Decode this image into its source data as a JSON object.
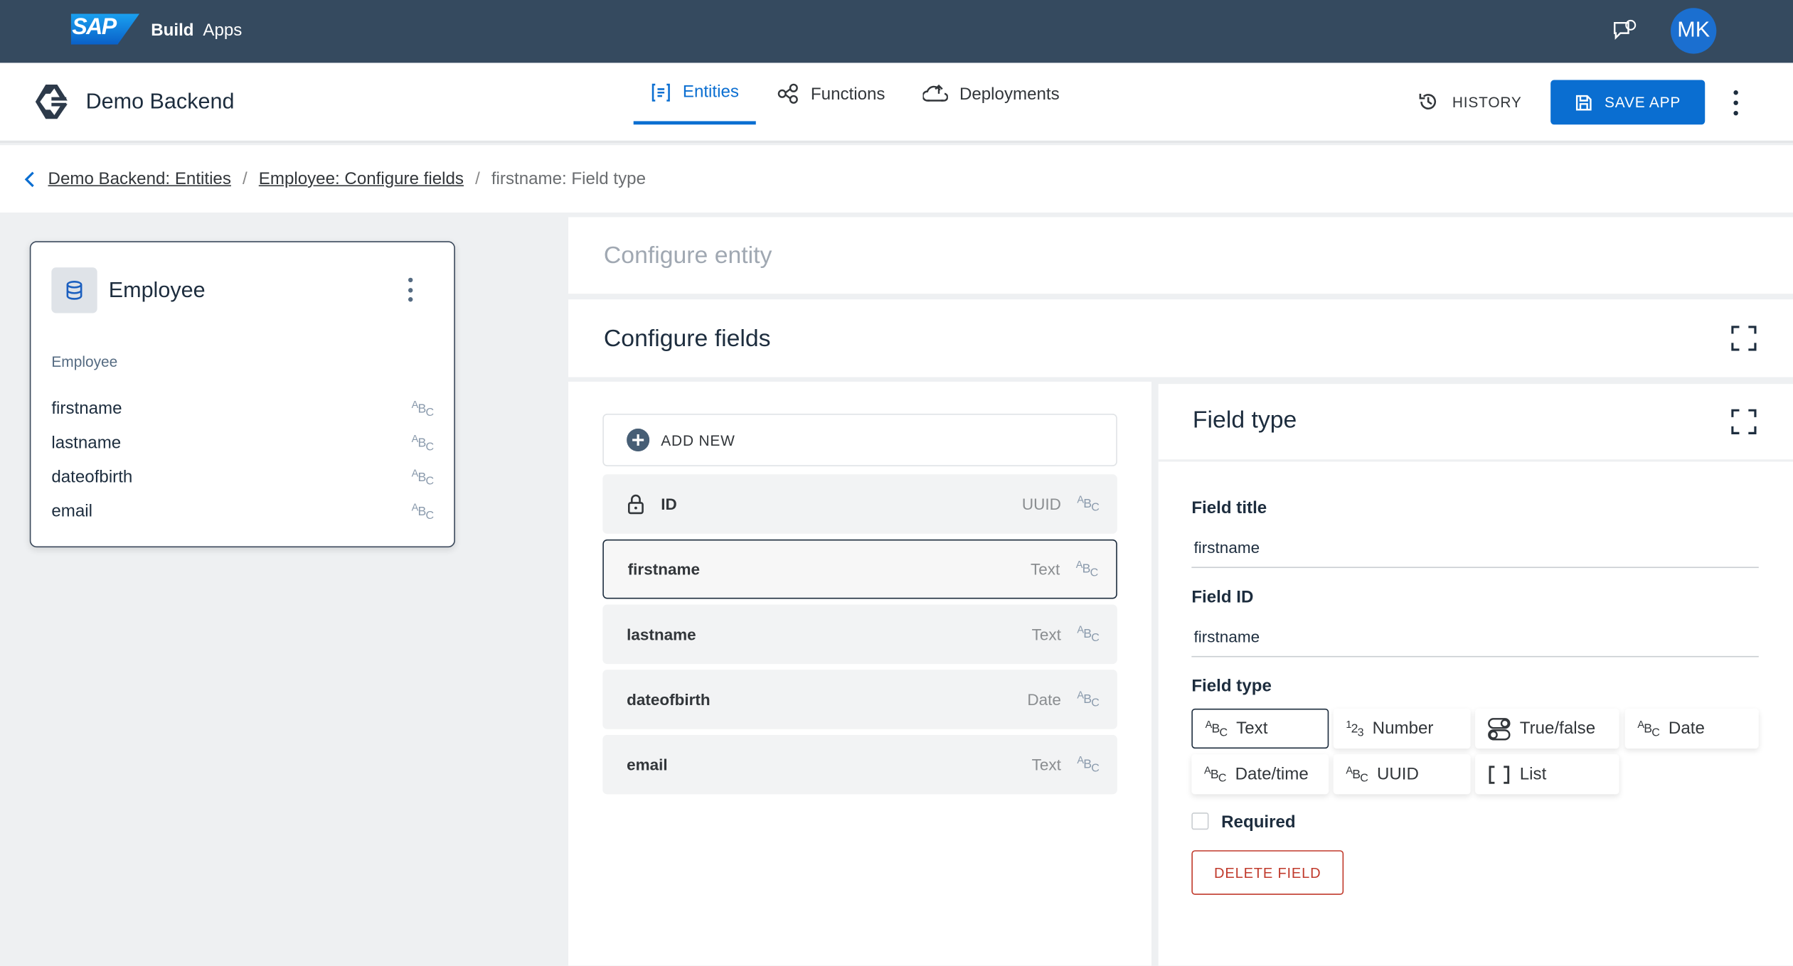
{
  "topbar": {
    "logo": "SAP",
    "product_bold": "Build",
    "product": "Apps",
    "avatar_initials": "MK"
  },
  "header": {
    "app_title": "Demo Backend",
    "tabs": [
      {
        "label": "Entities",
        "active": true
      },
      {
        "label": "Functions"
      },
      {
        "label": "Deployments"
      }
    ],
    "history_label": "HISTORY",
    "save_label": "SAVE APP"
  },
  "breadcrumb": {
    "items": [
      "Demo Backend: Entities",
      "Employee: Configure fields"
    ],
    "current": "firstname: Field type",
    "sep": "/"
  },
  "entity_card": {
    "title": "Employee",
    "subtitle": "Employee",
    "fields": [
      "firstname",
      "lastname",
      "dateofbirth",
      "email"
    ]
  },
  "configure_entity": {
    "title": "Configure entity"
  },
  "configure_fields": {
    "title": "Configure fields",
    "add_new": "ADD NEW",
    "items": [
      {
        "name": "ID",
        "type": "UUID",
        "locked": true
      },
      {
        "name": "firstname",
        "type": "Text",
        "selected": true
      },
      {
        "name": "lastname",
        "type": "Text"
      },
      {
        "name": "dateofbirth",
        "type": "Date"
      },
      {
        "name": "email",
        "type": "Text"
      }
    ]
  },
  "field_type_panel": {
    "title": "Field type",
    "field_title_label": "Field title",
    "field_title_value": "firstname",
    "field_id_label": "Field ID",
    "field_id_value": "firstname",
    "field_type_label": "Field type",
    "options": [
      {
        "label": "Text",
        "icon": "ABC",
        "selected": true
      },
      {
        "label": "Number",
        "icon": "123"
      },
      {
        "label": "True/false",
        "icon": "toggle"
      },
      {
        "label": "Date",
        "icon": "ABC"
      },
      {
        "label": "Date/time",
        "icon": "ABC"
      },
      {
        "label": "UUID",
        "icon": "ABC"
      },
      {
        "label": "List",
        "icon": "[ ]"
      }
    ],
    "required_label": "Required",
    "required_checked": false,
    "delete_label": "DELETE FIELD"
  },
  "colors": {
    "topbar": "#354a5f",
    "accent": "#0a6ed1",
    "danger": "#c0392b"
  }
}
